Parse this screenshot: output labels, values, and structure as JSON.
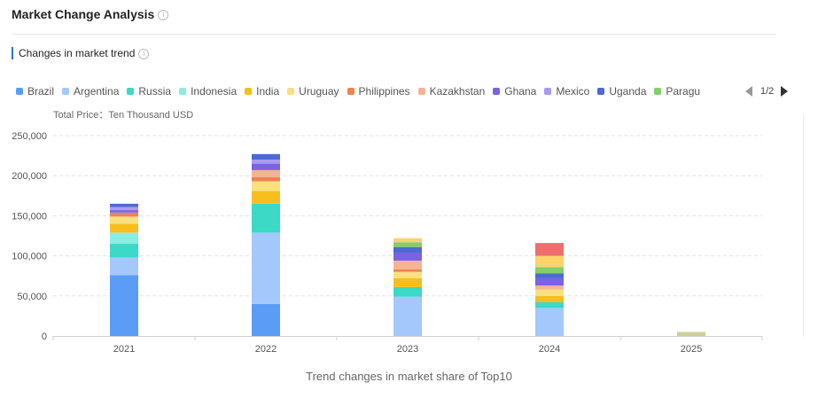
{
  "header": {
    "title": "Market Change Analysis",
    "info_symbol": "i"
  },
  "section": {
    "title": "Changes in market trend",
    "info_symbol": "i"
  },
  "legend": {
    "items": [
      {
        "label": "Brazil",
        "color": "#5b9cf7"
      },
      {
        "label": "Argentina",
        "color": "#a4c8fb"
      },
      {
        "label": "Russia",
        "color": "#3bd9c6"
      },
      {
        "label": "Indonesia",
        "color": "#8bece2"
      },
      {
        "label": "India",
        "color": "#f7be1e"
      },
      {
        "label": "Uruguay",
        "color": "#fbe07f"
      },
      {
        "label": "Philippines",
        "color": "#ee8450"
      },
      {
        "label": "Kazakhstan",
        "color": "#f4b492"
      },
      {
        "label": "Ghana",
        "color": "#7a62e4"
      },
      {
        "label": "Mexico",
        "color": "#a99af0"
      },
      {
        "label": "Uganda",
        "color": "#4d6ad2"
      },
      {
        "label": "Paragu",
        "color": "#84cf6c"
      }
    ],
    "pager": "1/2"
  },
  "unit_label": "Total Price：Ten Thousand USD",
  "chart_data": {
    "type": "bar",
    "stacked": true,
    "title": "Trend changes in market share of Top10",
    "categories": [
      "2021",
      "2022",
      "2023",
      "2024",
      "2025"
    ],
    "ylim": [
      0,
      250000
    ],
    "yticks": [
      0,
      50000,
      100000,
      150000,
      200000,
      250000
    ],
    "ytick_labels": [
      "0",
      "50,000",
      "100,000",
      "150,000",
      "200,000",
      "250,000"
    ],
    "grid": true,
    "legend_position": "top",
    "series": [
      {
        "name": "Brazil",
        "color": "#5b9cf7",
        "values": [
          76000,
          40000,
          0,
          0,
          0
        ]
      },
      {
        "name": "Argentina",
        "color": "#a4c8fb",
        "values": [
          22000,
          89000,
          49000,
          35000,
          0
        ]
      },
      {
        "name": "Russia",
        "color": "#3bd9c6",
        "values": [
          17000,
          36000,
          12000,
          7000,
          0
        ]
      },
      {
        "name": "Indonesia",
        "color": "#8bece2",
        "values": [
          14000,
          0,
          0,
          0,
          0
        ]
      },
      {
        "name": "India",
        "color": "#f7be1e",
        "values": [
          11000,
          16000,
          11000,
          8000,
          0
        ]
      },
      {
        "name": "Uruguay",
        "color": "#fbe07f",
        "values": [
          9000,
          12000,
          8000,
          8000,
          0
        ]
      },
      {
        "name": "Philippines",
        "color": "#ee8450",
        "values": [
          5000,
          5000,
          3000,
          0,
          0
        ]
      },
      {
        "name": "Kazakhstan",
        "color": "#f4b492",
        "values": [
          0,
          9000,
          11000,
          5000,
          0
        ]
      },
      {
        "name": "Ghana",
        "color": "#7a62e4",
        "values": [
          3000,
          8000,
          10000,
          9000,
          0
        ]
      },
      {
        "name": "Mexico",
        "color": "#a99af0",
        "values": [
          4000,
          5000,
          0,
          0,
          0
        ]
      },
      {
        "name": "Uganda",
        "color": "#4d6ad2",
        "values": [
          4000,
          7000,
          7000,
          6000,
          0
        ]
      },
      {
        "name": "Paragu",
        "color": "#84cf6c",
        "values": [
          0,
          0,
          6000,
          8000,
          0
        ]
      },
      {
        "name": "",
        "color": "#fbd36b",
        "values": [
          0,
          0,
          5000,
          14000,
          0
        ]
      },
      {
        "name": "",
        "color": "#f06d6d",
        "values": [
          0,
          0,
          0,
          16000,
          0
        ]
      },
      {
        "name": "",
        "color": "#cfcf9a",
        "values": [
          0,
          0,
          0,
          0,
          5000
        ]
      }
    ]
  }
}
